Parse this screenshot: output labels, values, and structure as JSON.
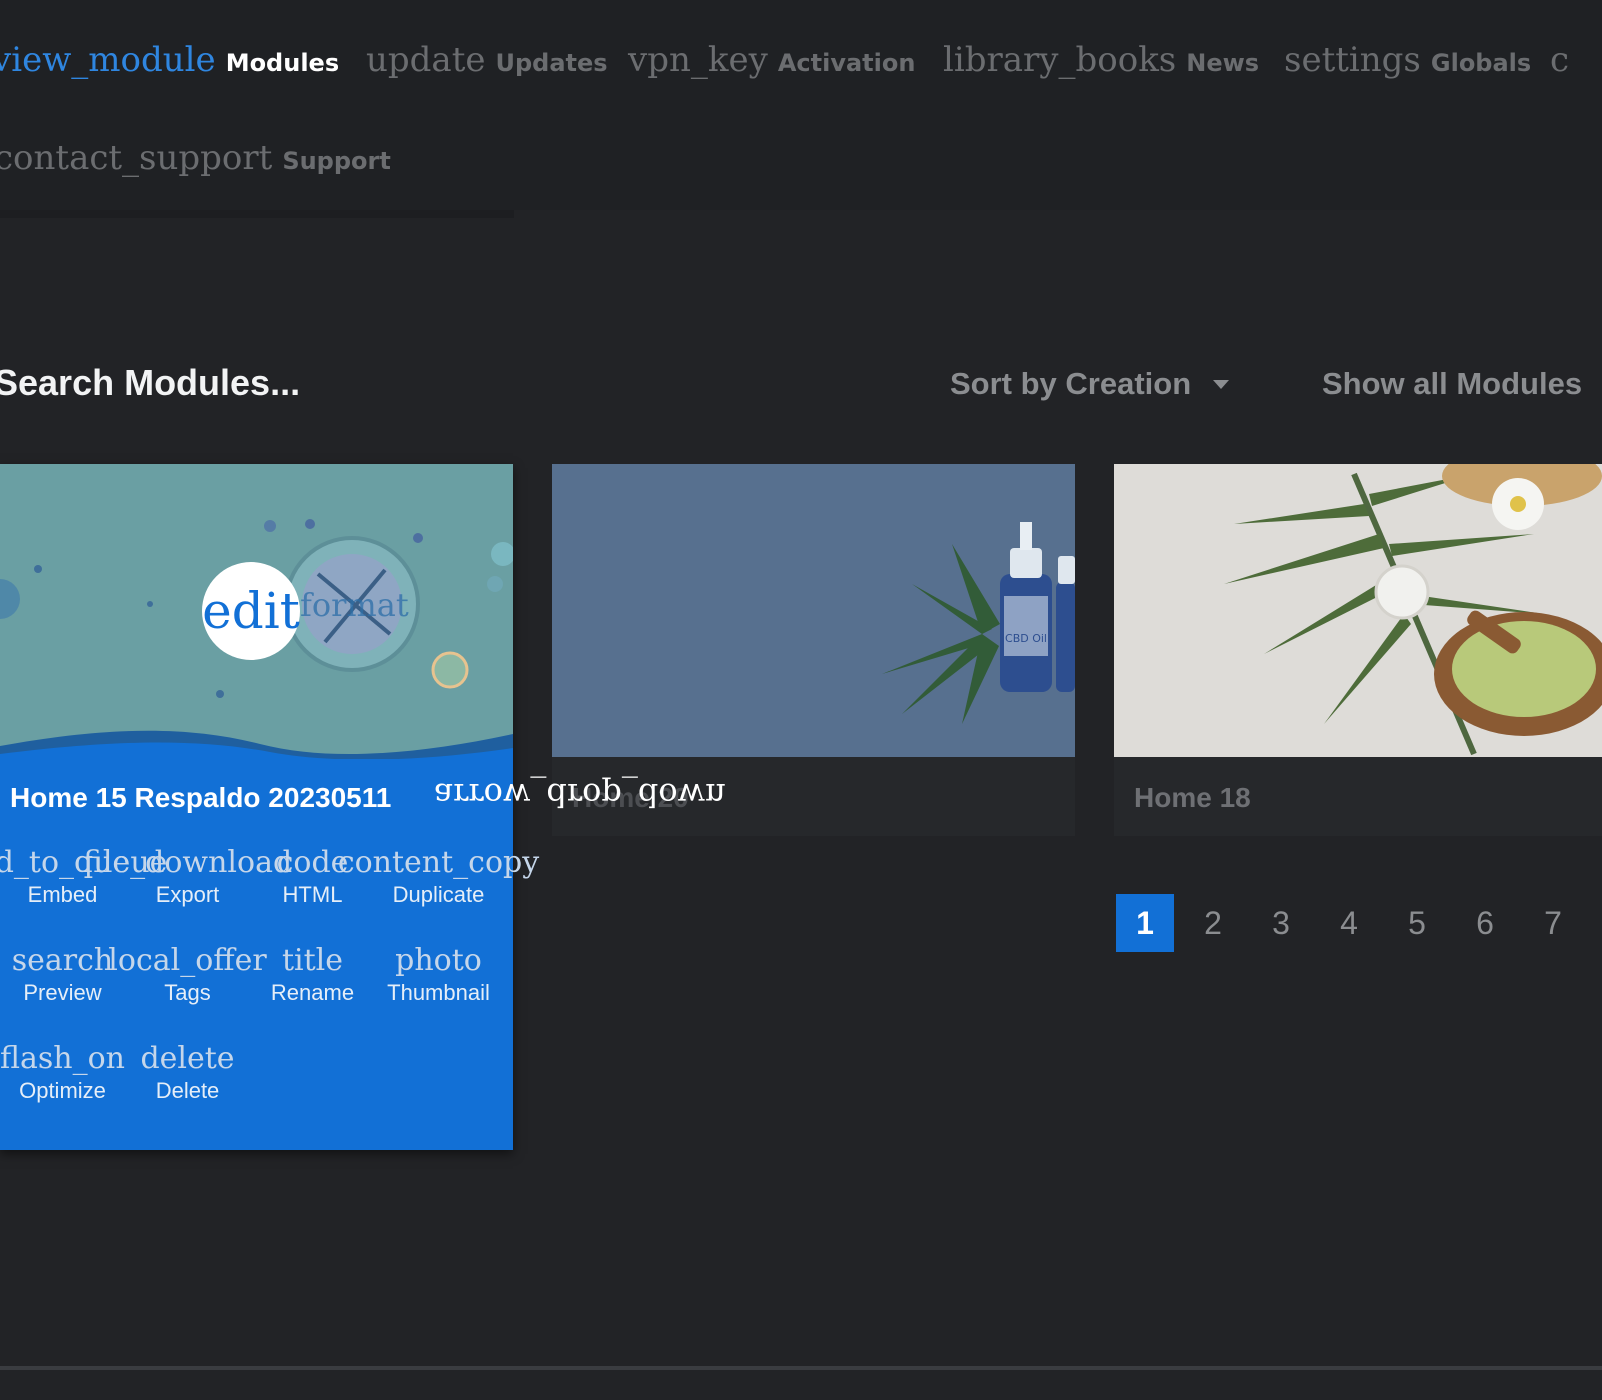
{
  "nav": {
    "items": [
      {
        "icon": "view_module",
        "label": "Modules"
      },
      {
        "icon": "update",
        "label": "Updates"
      },
      {
        "icon": "vpn_key",
        "label": "Activation"
      },
      {
        "icon": "library_books",
        "label": "News"
      },
      {
        "icon": "settings",
        "label": "Globals"
      },
      {
        "icon": "c",
        "label": ""
      },
      {
        "icon": "contact_support",
        "label": "Support"
      }
    ]
  },
  "toolbar": {
    "search_placeholder": "Search Modules...",
    "sort_label": "Sort by Creation",
    "filter_label": "Show all Modules"
  },
  "cards": [
    {
      "title": "Home 15 Respaldo 20230511",
      "edit_icon": "edit",
      "ghost_icon": "format",
      "actions": [
        {
          "icon": "add_to_queue",
          "label": "Embed"
        },
        {
          "icon": "file_download",
          "label": "Export"
        },
        {
          "icon": "code",
          "label": "HTML"
        },
        {
          "icon": "content_copy",
          "label": "Duplicate"
        },
        {
          "icon": "search",
          "label": "Preview"
        },
        {
          "icon": "local_offer",
          "label": "Tags"
        },
        {
          "icon": "title",
          "label": "Rename"
        },
        {
          "icon": "photo",
          "label": "Thumbnail"
        },
        {
          "icon": "flash_on",
          "label": "Optimize"
        },
        {
          "icon": "delete",
          "label": "Delete"
        }
      ]
    },
    {
      "title": "Home 20",
      "drag_icon": "drag_indicator"
    },
    {
      "title": "Home 18"
    }
  ],
  "overlay_icon": "arrow_drop_down",
  "pagination": {
    "pages": [
      "1",
      "2",
      "3",
      "4",
      "5",
      "6",
      "7"
    ],
    "current": "1"
  },
  "colors": {
    "accent": "#1270d6",
    "background": "#222326",
    "nav_bg": "#1f2124"
  }
}
